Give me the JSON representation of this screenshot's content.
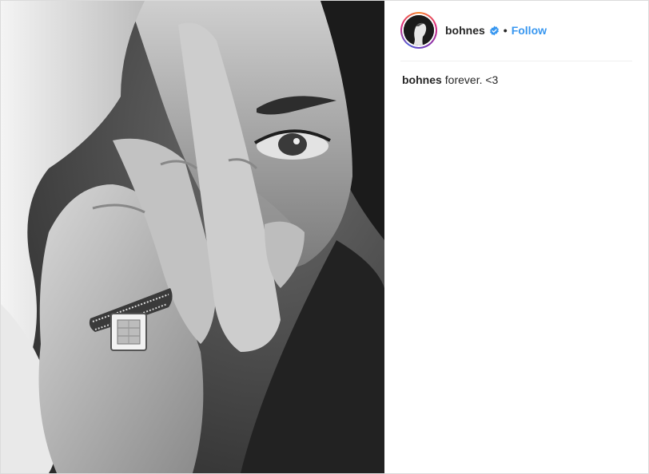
{
  "post": {
    "username": "bohnes",
    "verified": true,
    "separator": "•",
    "follow_label": "Follow",
    "caption_user": "bohnes",
    "caption_text": "forever. <3"
  },
  "colors": {
    "follow": "#3897f0",
    "verified_badge": "#3897f0",
    "text": "#262626",
    "divider": "#efefef"
  },
  "icons": {
    "verified": "verified-badge-icon",
    "avatar": "profile-avatar"
  }
}
